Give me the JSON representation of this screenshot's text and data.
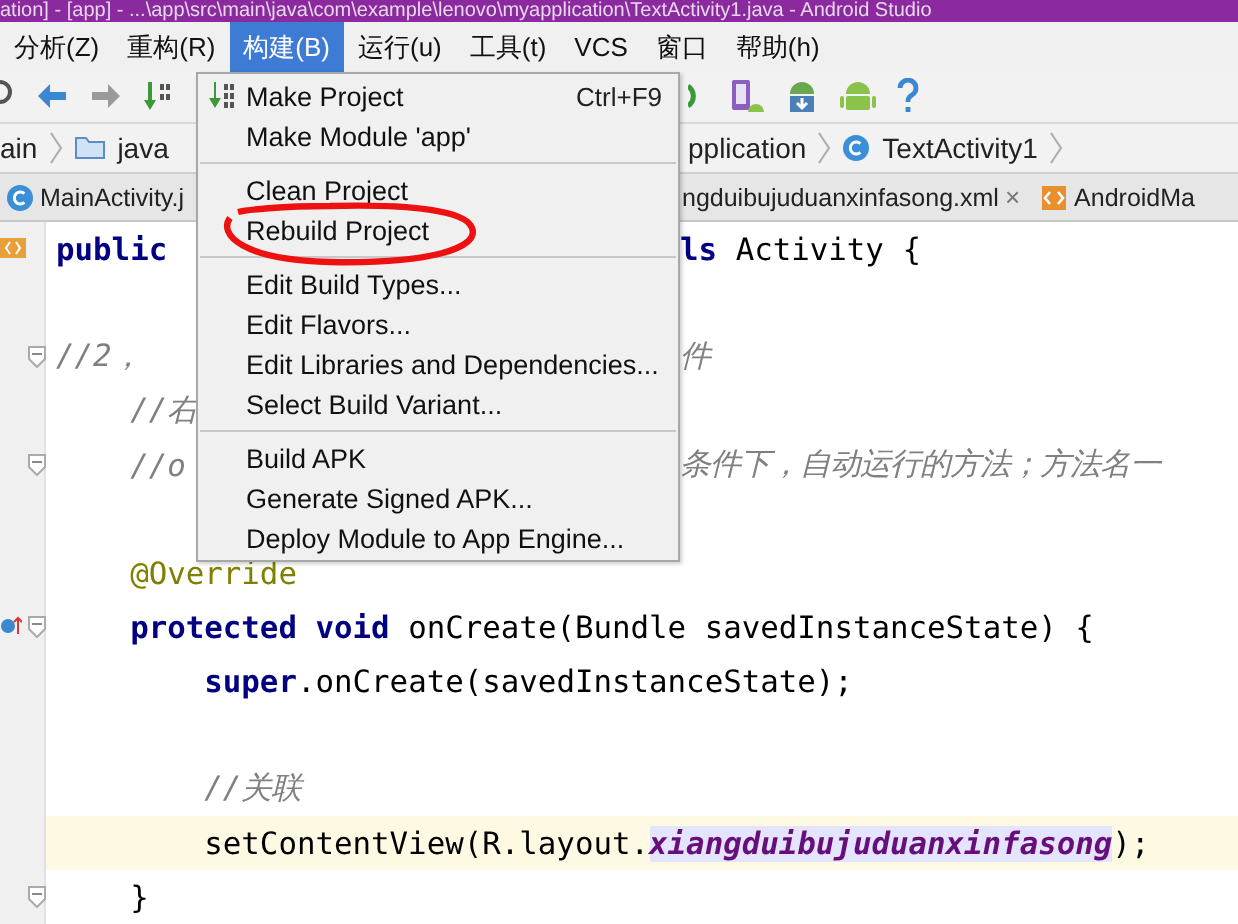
{
  "window": {
    "title": "ation] - [app] - ...\\app\\src\\main\\java\\com\\example\\lenovo\\myapplication\\TextActivity1.java - Android Studio"
  },
  "menubar": [
    {
      "label": "分析(Z)",
      "selected": false
    },
    {
      "label": "重构(R)",
      "selected": false
    },
    {
      "label": "构建(B)",
      "selected": true
    },
    {
      "label": "运行(u)",
      "selected": false
    },
    {
      "label": "工具(t)",
      "selected": false
    },
    {
      "label": "VCS",
      "selected": false
    },
    {
      "label": "窗口",
      "selected": false
    },
    {
      "label": "帮助(h)",
      "selected": false
    }
  ],
  "breadcrumbs": {
    "left": [
      "ain",
      "java"
    ],
    "right": [
      "pplication",
      "TextActivity1"
    ]
  },
  "tabs": {
    "left": [
      {
        "label": "MainActivity.j",
        "kind": "class"
      }
    ],
    "right": [
      {
        "label": "ngduibujuduanxinfasong.xml",
        "kind": "layout",
        "close": "×"
      },
      {
        "label": "AndroidMa",
        "kind": "manifest"
      }
    ]
  },
  "menu": {
    "items": [
      {
        "kind": "item",
        "label": "Make Project",
        "shortcut": "Ctrl+F9",
        "icon": true,
        "circled": false
      },
      {
        "kind": "item",
        "label": "Make Module 'app'",
        "circled": false
      },
      {
        "kind": "separator"
      },
      {
        "kind": "item",
        "label": "Clean Project",
        "circled": false
      },
      {
        "kind": "item",
        "label": "Rebuild Project",
        "circled": true
      },
      {
        "kind": "separator"
      },
      {
        "kind": "item",
        "label": "Edit Build Types...",
        "circled": false
      },
      {
        "kind": "item",
        "label": "Edit Flavors...",
        "circled": false
      },
      {
        "kind": "item",
        "label": "Edit Libraries and Dependencies...",
        "circled": false
      },
      {
        "kind": "item",
        "label": "Select Build Variant...",
        "circled": false
      },
      {
        "kind": "separator"
      },
      {
        "kind": "item",
        "label": "Build APK",
        "circled": false
      },
      {
        "kind": "item",
        "label": "Generate Signed APK...",
        "circled": false
      },
      {
        "kind": "item",
        "label": "Deploy Module to App Engine...",
        "circled": false
      }
    ]
  },
  "editor": {
    "lines": [
      {
        "kind": "code",
        "class_marker": true,
        "left": [
          {
            "kind": "keyword",
            "text": "public"
          }
        ],
        "right": [
          {
            "kind": "keyword",
            "text": "ls"
          },
          {
            "kind": "plain",
            "text": " Activity {"
          }
        ]
      },
      {
        "kind": "blank"
      },
      {
        "kind": "code",
        "fold": true,
        "left": [
          {
            "kind": "comment",
            "text": "//2，"
          }
        ],
        "right": [
          {
            "kind": "comment",
            "text": "件"
          }
        ]
      },
      {
        "kind": "code",
        "left": [
          {
            "kind": "comment",
            "text": "    //右"
          }
        ]
      },
      {
        "kind": "code",
        "fold": true,
        "left": [
          {
            "kind": "comment",
            "text": "    //o"
          }
        ],
        "right": [
          {
            "kind": "comment",
            "text": "条件下，自动运行的方法；方法名一"
          }
        ]
      },
      {
        "kind": "blank"
      },
      {
        "kind": "code",
        "left": [
          {
            "kind": "annotation",
            "text": "    @Override"
          }
        ]
      },
      {
        "kind": "code",
        "override_marker": true,
        "fold": true,
        "left": [
          {
            "kind": "keyword",
            "text": "    protected"
          },
          {
            "kind": "keyword",
            "text": " void"
          },
          {
            "kind": "plain",
            "text": " onCreate(Bundle savedInstanceState) {"
          }
        ]
      },
      {
        "kind": "code",
        "left": [
          {
            "kind": "keyword",
            "text": "        super"
          },
          {
            "kind": "plain",
            "text": ".onCreate(savedInstanceState);"
          }
        ]
      },
      {
        "kind": "blank"
      },
      {
        "kind": "code",
        "left": [
          {
            "kind": "comment",
            "text": "        //关联"
          }
        ]
      },
      {
        "kind": "code",
        "current": true,
        "left": [
          {
            "kind": "plain",
            "text": "        setContentView(R.layout."
          },
          {
            "kind": "field",
            "text": "xiangduibujuduanxinfasong"
          },
          {
            "kind": "plain",
            "text": ");"
          }
        ]
      },
      {
        "kind": "code",
        "fold": true,
        "left": [
          {
            "kind": "plain",
            "text": "    }"
          }
        ]
      }
    ]
  }
}
